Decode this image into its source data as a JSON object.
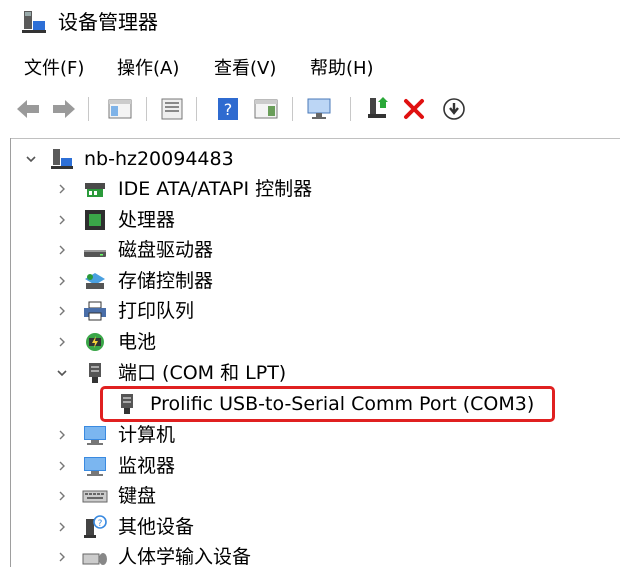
{
  "window": {
    "title": "设备管理器",
    "icon": "device-manager-icon"
  },
  "menu": {
    "file": "文件(F)",
    "action": "操作(A)",
    "view": "查看(V)",
    "help": "帮助(H)"
  },
  "toolbar": {
    "icons": [
      "back-arrow-icon",
      "forward-arrow-icon",
      "show-hide-console-tree-icon",
      "properties-icon",
      "help-icon",
      "update-driver-icon",
      "scan-hardware-icon",
      "add-legacy-hardware-icon",
      "uninstall-x-icon",
      "download-circle-icon"
    ]
  },
  "tree": {
    "root": "nb-hz20094483",
    "items": [
      {
        "label": "IDE ATA/ATAPI 控制器",
        "icon": "ide-controller-icon",
        "expanded": false
      },
      {
        "label": "处理器",
        "icon": "processor-icon",
        "expanded": false
      },
      {
        "label": "磁盘驱动器",
        "icon": "disk-drive-icon",
        "expanded": false
      },
      {
        "label": "存储控制器",
        "icon": "storage-controller-icon",
        "expanded": false
      },
      {
        "label": "打印队列",
        "icon": "printer-icon",
        "expanded": false
      },
      {
        "label": "电池",
        "icon": "battery-icon",
        "expanded": false
      },
      {
        "label": "端口 (COM 和 LPT)",
        "icon": "port-icon",
        "expanded": true,
        "children": [
          {
            "label": "Prolific USB-to-Serial Comm Port (COM3)",
            "icon": "serial-port-icon"
          }
        ]
      },
      {
        "label": "计算机",
        "icon": "computer-icon",
        "expanded": false
      },
      {
        "label": "监视器",
        "icon": "monitor-icon",
        "expanded": false
      },
      {
        "label": "键盘",
        "icon": "keyboard-icon",
        "expanded": false
      },
      {
        "label": "其他设备",
        "icon": "other-devices-icon",
        "expanded": false
      },
      {
        "label": "人体学输入设备",
        "icon": "hid-icon",
        "expanded": false
      }
    ]
  },
  "highlight_color": "#e02020"
}
